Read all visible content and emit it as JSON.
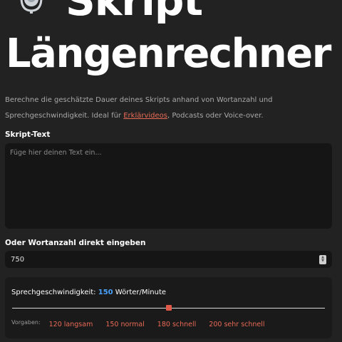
{
  "header": {
    "title_line1": "Skript",
    "title_line2": "Längenrechner"
  },
  "description": {
    "text_before_link": "Berechne die geschätzte Dauer deines Skripts anhand von Wortanzahl und Sprechgeschwindigkeit. Ideal für ",
    "link_text": "Erklärvideos",
    "text_after_link": ", Podcasts oder Voice-over."
  },
  "script_field": {
    "label": "Skript-Text",
    "placeholder": "Füge hier deinen Text ein..."
  },
  "word_count": {
    "label": "Oder Wortanzahl direkt eingeben",
    "value": "750"
  },
  "speed": {
    "label_prefix": "Sprechgeschwindigkeit:",
    "value": "150",
    "unit": "Wörter/Minute",
    "slider_fraction": 0.5,
    "presets_label": "Vorgaben:",
    "presets": [
      "120 langsam",
      "150 normal",
      "180 schnell",
      "200 sehr schnell"
    ]
  },
  "colors": {
    "background": "#222222",
    "accent_red": "#e86a55",
    "accent_blue": "#4aa3ff"
  }
}
